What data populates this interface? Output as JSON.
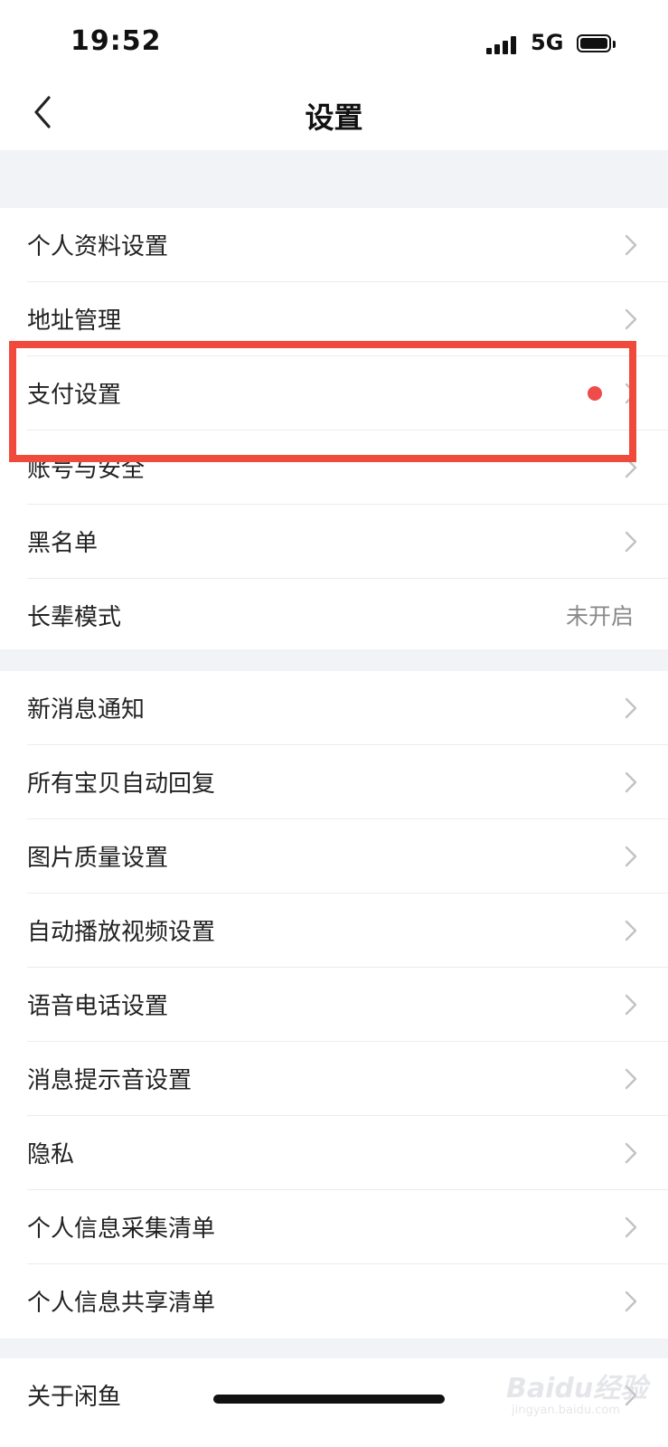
{
  "status_bar": {
    "time": "19:52",
    "network": "5G",
    "icons": [
      "signal-icon",
      "battery-icon"
    ]
  },
  "nav": {
    "title": "设置",
    "back_icon": "chevron-left-icon"
  },
  "group1": [
    {
      "label": "个人资料设置"
    },
    {
      "label": "地址管理"
    },
    {
      "label": "支付设置"
    },
    {
      "label": "账号与安全"
    },
    {
      "label": "黑名单"
    },
    {
      "label": "长辈模式",
      "value": "未开启"
    }
  ],
  "group2": [
    {
      "label": "新消息通知"
    },
    {
      "label": "所有宝贝自动回复"
    },
    {
      "label": "图片质量设置"
    },
    {
      "label": "自动播放视频设置"
    },
    {
      "label": "语音电话设置"
    },
    {
      "label": "消息提示音设置"
    },
    {
      "label": "隐私"
    },
    {
      "label": "个人信息采集清单"
    },
    {
      "label": "个人信息共享清单"
    }
  ],
  "group3": [
    {
      "label": "关于闲鱼"
    }
  ],
  "colors": {
    "highlight": "#f04a3c",
    "badge_dot": "#ef4b4b",
    "background": "#f2f3f7",
    "secondary_text": "#8a8a8a"
  },
  "watermark": {
    "text": "Baidu经验",
    "sub": "jingyan.baidu.com"
  }
}
